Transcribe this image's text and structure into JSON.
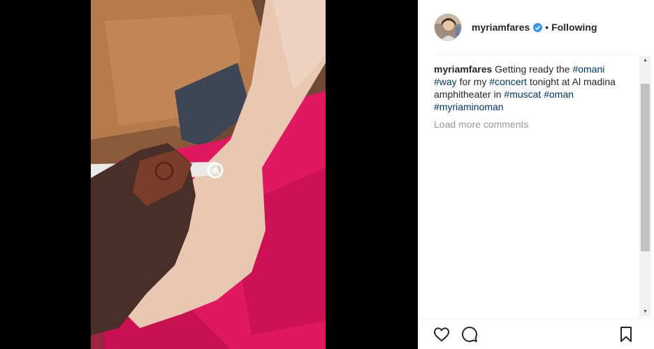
{
  "header": {
    "username": "myriamfares",
    "separator": "•",
    "follow_status": "Following"
  },
  "caption": {
    "username": "myriamfares",
    "text_1": " Getting ready the ",
    "tag_omani": "#omani",
    "text_2": " ",
    "tag_way": "#way",
    "text_3": " for my ",
    "tag_concert": "#concert",
    "text_4": " tonight at Al madina amphitheater in ",
    "tag_muscat": "#muscat",
    "text_5": " ",
    "tag_oman": "#oman",
    "text_6": " ",
    "tag_myriaminoman": "#myriaminoman"
  },
  "load_more": "Load more comments",
  "scrollbar": {
    "up_arrow": "▲",
    "down_arrow": "▼"
  },
  "icons": {
    "like": "heart-icon",
    "comment": "speech-bubble-icon",
    "save": "bookmark-icon",
    "verified": "verified-badge-icon"
  },
  "colors": {
    "hashtag": "#003569",
    "verified": "#3897f0",
    "muted": "#999999",
    "text": "#262626"
  }
}
